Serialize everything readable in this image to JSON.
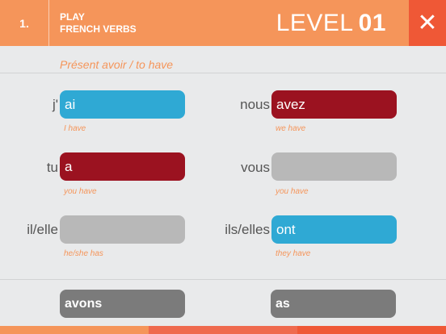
{
  "header": {
    "step": "1.",
    "title_line1": "PLAY",
    "title_line2": "FRENCH VERBS",
    "level_label": "LEVEL",
    "level_number": "01",
    "close_symbol": "✕"
  },
  "subtitle": "Présent avoir / to have",
  "conjugations": [
    {
      "pronoun": "j'",
      "answer": "ai",
      "hint": "I have",
      "state": "correct"
    },
    {
      "pronoun": "nous",
      "answer": "avez",
      "hint": "we have",
      "state": "wrong"
    },
    {
      "pronoun": "tu",
      "answer": "a",
      "hint": "you have",
      "state": "wrong"
    },
    {
      "pronoun": "vous",
      "answer": "",
      "hint": "you have",
      "state": "empty"
    },
    {
      "pronoun": "il/elle",
      "answer": "",
      "hint": "he/she has",
      "state": "empty"
    },
    {
      "pronoun": "ils/elles",
      "answer": "ont",
      "hint": "they have",
      "state": "correct"
    }
  ],
  "word_bank": [
    "avons",
    "as"
  ],
  "colors": {
    "orange": "#f5955a",
    "close_red": "#ef5836",
    "correct_blue": "#2fa9d4",
    "wrong_red": "#9b1220",
    "empty_gray": "#b8b8b8",
    "word_gray": "#7b7b7b",
    "bottom_bar": [
      "#f5955a",
      "#ef6a4e",
      "#ef5836"
    ]
  }
}
